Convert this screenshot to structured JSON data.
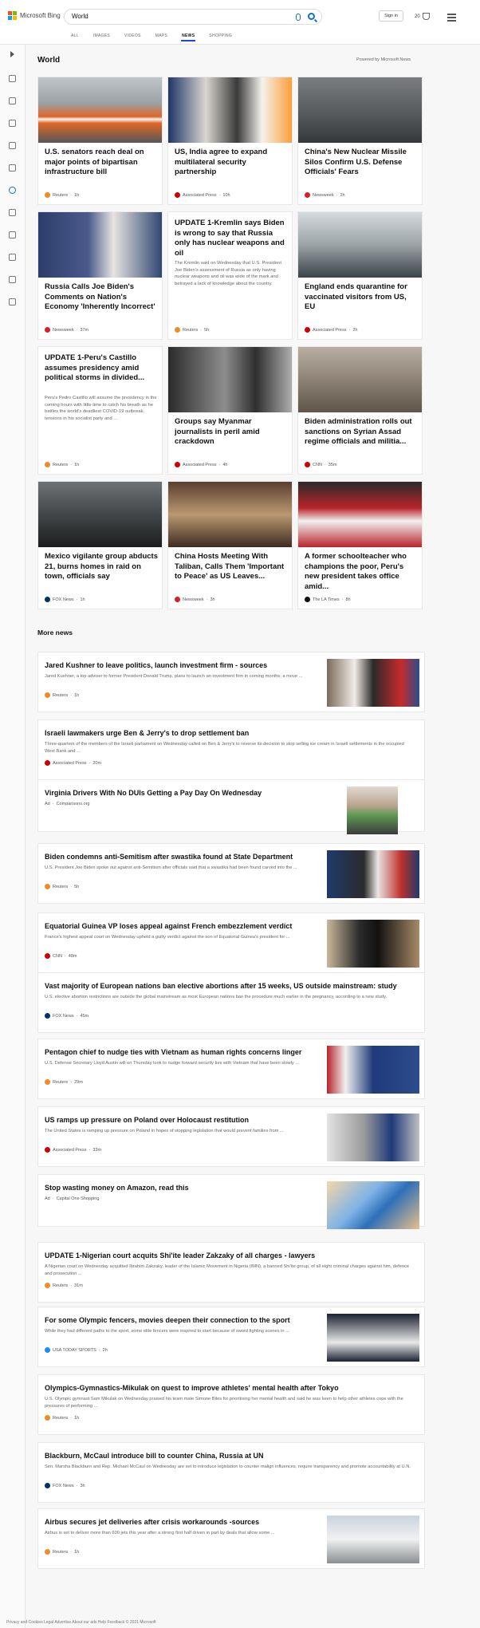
{
  "header": {
    "logo_text": "Microsoft Bing",
    "search_value": "World",
    "signin": "Sign in",
    "rewards_count": "20"
  },
  "tabs": [
    "ALL",
    "IMAGES",
    "VIDEOS",
    "MAPS",
    "NEWS",
    "SHOPPING"
  ],
  "section": {
    "title": "World",
    "powered": "Powered by Microsoft News"
  },
  "cards": [
    {
      "title": "U.S. senators reach deal on major points of bipartisan infrastructure bill",
      "source": "Reuters",
      "time": "1h",
      "fav": "#f08c28",
      "img": "ramp closed sign with cones"
    },
    {
      "title": "US, India agree to expand multilateral security partnership",
      "source": "Associated Press",
      "time": "10h",
      "fav": "#c00",
      "img": "officials with flags"
    },
    {
      "title": "China's New Nuclear Missile Silos Confirm U.S. Defense Officials' Fears",
      "source": "Newsweek",
      "time": "2h",
      "fav": "#d9202a",
      "img": "missile on parade"
    },
    {
      "title": "Russia Calls Joe Biden's Comments on Nation's Economy 'Inherently Incorrect'",
      "source": "Newsweek",
      "time": "37m",
      "fav": "#d9202a",
      "img": "Biden speaking"
    },
    {
      "title": "UPDATE 1-Kremlin says Biden is wrong to say that Russia only has nuclear weapons and oil",
      "desc": "The Kremlin said on Wednesday that U.S. President Joe Biden's assessment of Russia as only having nuclear weapons and oil was wide of the mark and betrayed a lack of knowledge about the country.",
      "source": "Reuters",
      "time": "5h",
      "fav": "#f08c28"
    },
    {
      "title": "England ends quarantine for vaccinated visitors from US, EU",
      "source": "Associated Press",
      "time": "2h",
      "fav": "#c00",
      "img": "airport terminal"
    },
    {
      "title": "UPDATE 1-Peru's Castillo assumes presidency amid political storms in divided...",
      "desc": "Peru's Pedro Castillo will assume the presidency in the coming hours with little time to catch his breath as he battles the world's deadliest COVID-19 outbreak, tensions in his socialist party and ...",
      "source": "Reuters",
      "time": "1h",
      "fav": "#f08c28"
    },
    {
      "title": "Groups say Myanmar journalists in peril amid crackdown",
      "source": "Associated Press",
      "time": "4h",
      "fav": "#c00",
      "img": "journalist portrait"
    },
    {
      "title": "Biden administration rolls out sanctions on Syrian Assad regime officials and militia...",
      "source": "CNN",
      "time": "35m",
      "fav": "#cc0000",
      "img": "damaged buildings"
    },
    {
      "title": "Mexico vigilante group abducts 21, burns homes in raid on town, officials say",
      "source": "FOX News",
      "time": "1h",
      "fav": "#003366",
      "img": "armed group"
    },
    {
      "title": "China Hosts Meeting With Taliban, Calls Them 'Important to Peace' as US Leaves...",
      "source": "Newsweek",
      "time": "3h",
      "fav": "#d9202a",
      "img": "meeting room"
    },
    {
      "title": "A former schoolteacher who champions the poor, Peru's new president takes office amid...",
      "source": "The LA Times",
      "time": "8h",
      "fav": "#111",
      "img": "man in hat with pencil"
    }
  ],
  "more": {
    "title": "More news"
  },
  "rows": [
    {
      "title": "Jared Kushner to leave politics, launch investment firm - sources",
      "desc": "Jared Kushner, a top adviser to former President Donald Trump, plans to launch an investment firm in coming months, a move ...",
      "source": "Reuters",
      "time": "1h",
      "fav": "#f08c28",
      "img": "Kushner portrait"
    },
    {
      "title": "Israeli lawmakers urge Ben & Jerry's to drop settlement ban",
      "desc": "Three-quarters of the members of the Israeli parliament on Wednesday called on Ben & Jerry's to reverse its decision to stop selling ice cream in Israeli settlements in the occupied West Bank and ...",
      "source": "Associated Press",
      "time": "20m",
      "fav": "#c00"
    },
    {
      "title": "Virginia Drivers With No DUIs Getting a Pay Day On Wednesday",
      "source": "Comparisons.org",
      "ad": "Ad",
      "fav": "",
      "img": "man holding card"
    },
    {
      "title": "Biden condemns anti-Semitism after swastika found at State Department",
      "desc": "U.S. President Joe Biden spoke out against anti-Semitism after officials said that a swastika had been found carved into the ...",
      "source": "Reuters",
      "time": "5h",
      "fav": "#f08c28",
      "img": "Biden portrait"
    },
    {
      "title": "Equatorial Guinea VP loses appeal against French embezzlement verdict",
      "desc": "France's highest appeal court on Wednesday upheld a guilty verdict against the son of Equatorial Guinea's president for ...",
      "source": "CNN",
      "time": "48m",
      "fav": "#cc0000",
      "img": "officials"
    },
    {
      "title": "Vast majority of European nations ban elective abortions after 15 weeks, US outside mainstream: study",
      "desc": "U.S. elective abortion restrictions are outside the global mainstream as most European nations ban the procedure much earlier in the pregnancy, according to a new study.",
      "source": "FOX News",
      "time": "45m",
      "fav": "#003366"
    },
    {
      "title": "Pentagon chief to nudge ties with Vietnam as human rights concerns linger",
      "desc": "U.S. Defense Secretary Lloyd Austin will on Thursday look to nudge forward security ties with Vietnam that have been slowly ...",
      "source": "Reuters",
      "time": "29m",
      "fav": "#f08c28",
      "img": "Austin at podium"
    },
    {
      "title": "US ramps up pressure on Poland over Holocaust restitution",
      "desc": "The United States is ramping up pressure on Poland in hopes of stopping legislation that would prevent families from ...",
      "source": "Associated Press",
      "time": "33m",
      "fav": "#c00",
      "img": "official at podium"
    },
    {
      "title": "Stop wasting money on Amazon, read this",
      "source": "Capital One Shopping",
      "ad": "Ad",
      "fav": "",
      "img": "amazon box"
    },
    {
      "title": "UPDATE 1-Nigerian court acquits Shi'ite leader Zakzaky of all charges - lawyers",
      "desc": "A Nigerian court on Wednesday acquitted Ibrahim Zakzaky, leader of the Islamic Movement in Nigeria (IMN), a banned Shi'ite group, of all eight criminal charges against him, defence and prosecution ...",
      "source": "Reuters",
      "time": "31m",
      "fav": "#f08c28"
    },
    {
      "title": "For some Olympic fencers, movies deepen their connection to the sport",
      "desc": "While they had different paths to the sport, some elite fencers were inspired to start because of sword fighting scenes in ...",
      "source": "USA TODAY SPORTS",
      "time": "2h",
      "fav": "#1a8cff",
      "img": "fencers"
    },
    {
      "title": "Olympics-Gymnastics-Mikulak on quest to improve athletes' mental health after Tokyo",
      "desc": "U.S. Olympic gymnast Sam Mikulak on Wednesday praised his team mate Simone Biles for prioritising her mental health and said he was keen to help other athletes cope with the pressures of performing ...",
      "source": "Reuters",
      "time": "1h",
      "fav": "#f08c28"
    },
    {
      "title": "Blackburn, McCaul introduce bill to counter China, Russia at UN",
      "desc": "Sen. Marsha Blackburn and Rep. Michael McCaul on Wednesday are set to introduce legislation to counter malign influences, require transparency and promote accountability at U.N.",
      "source": "FOX News",
      "time": "3h",
      "fav": "#003366"
    },
    {
      "title": "Airbus secures jet deliveries after crisis workarounds -sources",
      "desc": "Airbus is set to deliver more than 600 jets this year after a strong first half driven in part by deals that allow some ...",
      "source": "Reuters",
      "time": "1h",
      "fav": "#f08c28",
      "img": "airplane"
    }
  ],
  "footer": {
    "text": "Privacy and Cookies   Legal   Advertise   About our ads   Help   Feedback        © 2021 Microsoft"
  }
}
